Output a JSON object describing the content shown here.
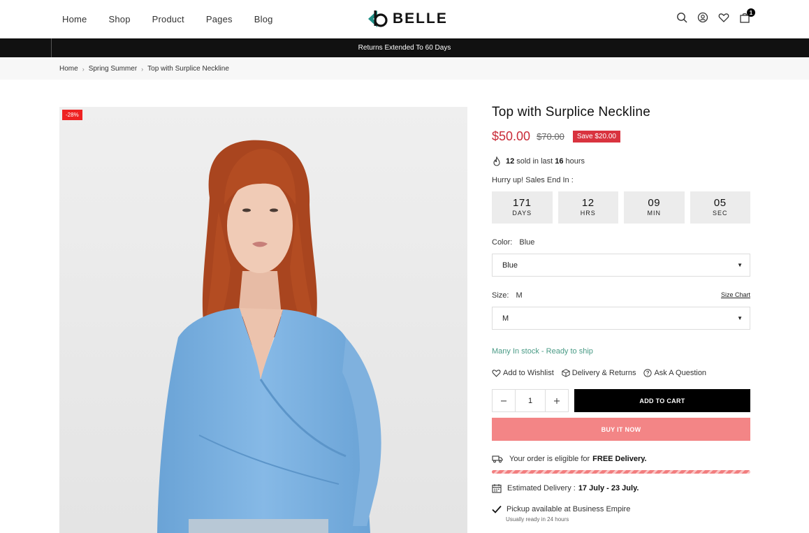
{
  "header": {
    "nav": [
      "Home",
      "Shop",
      "Product",
      "Pages",
      "Blog"
    ],
    "logo_text": "BELLE",
    "cart_count": "1"
  },
  "announcement": "Returns Extended To 60 Days",
  "breadcrumb": [
    "Home",
    "Spring Summer",
    "Top with Surplice Neckline"
  ],
  "gallery": {
    "discount_badge": "-28%"
  },
  "product": {
    "title": "Top with Surplice Neckline",
    "price": "$50.00",
    "old_price": "$70.00",
    "save": "Save $20.00",
    "sold_count": "12",
    "sold_text": "sold in last",
    "sold_hours": "16",
    "sold_suffix": "hours",
    "hurry_text": "Hurry up! Sales End In :",
    "countdown": [
      {
        "value": "171",
        "unit": "DAYS"
      },
      {
        "value": "12",
        "unit": "HRS"
      },
      {
        "value": "09",
        "unit": "MIN"
      },
      {
        "value": "05",
        "unit": "SEC"
      }
    ],
    "color_label": "Color:",
    "color_value": "Blue",
    "color_select": "Blue",
    "size_label": "Size:",
    "size_value": "M",
    "size_chart": "Size Chart",
    "size_select": "M",
    "stock": "Many In stock - Ready to ship",
    "actions": [
      "Add to Wishlist",
      "Delivery & Returns",
      "Ask A Question"
    ],
    "quantity": "1",
    "add_to_cart": "ADD TO CART",
    "buy_now": "BUY IT NOW",
    "free_delivery_text": "Your order is eligible for",
    "free_delivery_bold": "FREE Delivery.",
    "estimated_label": "Estimated Delivery :",
    "estimated_range": "17 July - 23 July.",
    "pickup_text": "Pickup available at Business Empire",
    "pickup_note": "Usually ready in 24 hours"
  },
  "colors": {
    "price_red": "#c92b38",
    "save_red": "#d9333f",
    "buy_now_pink": "#f38586",
    "stock_green": "#4a9b86",
    "logo_teal": "#1f8f86"
  }
}
